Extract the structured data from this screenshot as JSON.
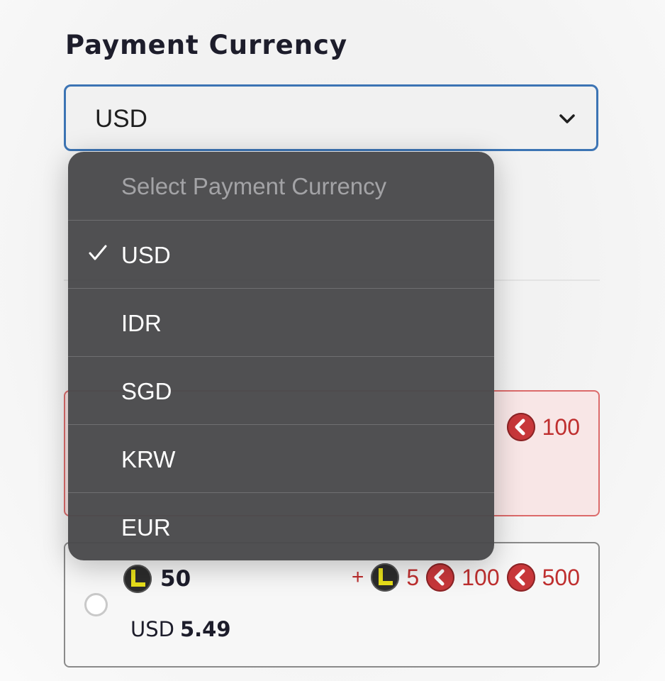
{
  "heading": "Payment Currency",
  "select": {
    "value": "USD",
    "chevron_icon": "chevron-down-icon"
  },
  "dropdown": {
    "placeholder": "Select Payment Currency",
    "options": [
      "USD",
      "IDR",
      "SGD",
      "KRW",
      "EUR"
    ],
    "selected": "USD",
    "check_icon": "checkmark-icon"
  },
  "card1": {
    "bonus_value": "100",
    "bonus_icon": "red-coin-icon"
  },
  "card2": {
    "base_amount": "50",
    "base_icon": "yellow-coin-icon",
    "bonus_plus": "+",
    "bonus_items": [
      {
        "icon": "yellow-coin-icon",
        "value": "5"
      },
      {
        "icon": "red-coin-icon",
        "value": "100"
      },
      {
        "icon": "red-coin-icon",
        "value": "500"
      }
    ],
    "price_currency": "USD",
    "price_amount": "5.49"
  },
  "colors": {
    "select_border": "#3c74b4",
    "bonus_red": "#bf2f2f",
    "dropdown_bg": "#4a4a4c"
  }
}
